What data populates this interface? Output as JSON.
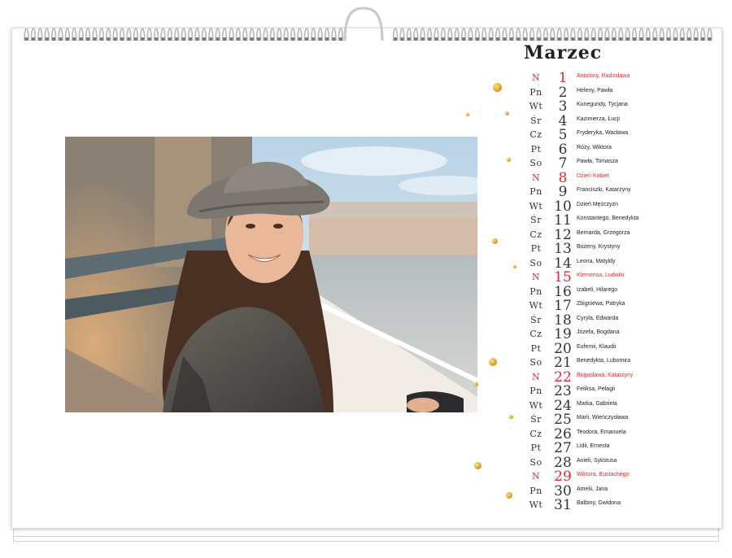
{
  "calendar": {
    "month": "Marzec",
    "holiday_color": "#e32636",
    "days": [
      {
        "dow": "N",
        "day": "1",
        "names": "Antoniny, Radosława",
        "holiday": true
      },
      {
        "dow": "Pn",
        "day": "2",
        "names": "Heleny, Pawła",
        "holiday": false
      },
      {
        "dow": "Wt",
        "day": "3",
        "names": "Kunegundy, Tycjana",
        "holiday": false
      },
      {
        "dow": "Śr",
        "day": "4",
        "names": "Kazimierza, Łucji",
        "holiday": false
      },
      {
        "dow": "Cz",
        "day": "5",
        "names": "Fryderyka, Wacława",
        "holiday": false
      },
      {
        "dow": "Pt",
        "day": "6",
        "names": "Róży, Wiktora",
        "holiday": false
      },
      {
        "dow": "So",
        "day": "7",
        "names": "Pawła, Tomasza",
        "holiday": false
      },
      {
        "dow": "N",
        "day": "8",
        "names": "Dzień Kobiet",
        "holiday": true
      },
      {
        "dow": "Pn",
        "day": "9",
        "names": "Franciszki, Katarzyny",
        "holiday": false
      },
      {
        "dow": "Wt",
        "day": "10",
        "names": "Dzień Mężczyzn",
        "holiday": false
      },
      {
        "dow": "Śr",
        "day": "11",
        "names": "Konstantego, Benedykta",
        "holiday": false
      },
      {
        "dow": "Cz",
        "day": "12",
        "names": "Bernarda, Grzegorza",
        "holiday": false
      },
      {
        "dow": "Pt",
        "day": "13",
        "names": "Bożeny, Krystyny",
        "holiday": false
      },
      {
        "dow": "So",
        "day": "14",
        "names": "Leona, Matyldy",
        "holiday": false
      },
      {
        "dow": "N",
        "day": "15",
        "names": "Klemensa, Ludwiki",
        "holiday": true
      },
      {
        "dow": "Pn",
        "day": "16",
        "names": "Izabeli, Hilarego",
        "holiday": false
      },
      {
        "dow": "Wt",
        "day": "17",
        "names": "Zbigniewa, Patryka",
        "holiday": false
      },
      {
        "dow": "Śr",
        "day": "18",
        "names": "Cyryla, Edwarda",
        "holiday": false
      },
      {
        "dow": "Cz",
        "day": "19",
        "names": "Józefa, Bogdana",
        "holiday": false
      },
      {
        "dow": "Pt",
        "day": "20",
        "names": "Eufemii, Klaudii",
        "holiday": false
      },
      {
        "dow": "So",
        "day": "21",
        "names": "Benedykta, Lubomira",
        "holiday": false
      },
      {
        "dow": "N",
        "day": "22",
        "names": "Bogusława, Katarzyny",
        "holiday": true
      },
      {
        "dow": "Pn",
        "day": "23",
        "names": "Feliksa, Pelagii",
        "holiday": false
      },
      {
        "dow": "Wt",
        "day": "24",
        "names": "Marka, Gabriela",
        "holiday": false
      },
      {
        "dow": "Śr",
        "day": "25",
        "names": "Marii, Wieńczysława",
        "holiday": false
      },
      {
        "dow": "Cz",
        "day": "26",
        "names": "Teodora, Emanuela",
        "holiday": false
      },
      {
        "dow": "Pt",
        "day": "27",
        "names": "Lidii, Ernesta",
        "holiday": false
      },
      {
        "dow": "So",
        "day": "28",
        "names": "Anieli, Sykstusa",
        "holiday": false
      },
      {
        "dow": "N",
        "day": "29",
        "names": "Wiktora, Eustachego",
        "holiday": true
      },
      {
        "dow": "Pn",
        "day": "30",
        "names": "Amelii, Jana",
        "holiday": false
      },
      {
        "dow": "Wt",
        "day": "31",
        "names": "Balbiny, Gwidona",
        "holiday": false
      }
    ]
  }
}
